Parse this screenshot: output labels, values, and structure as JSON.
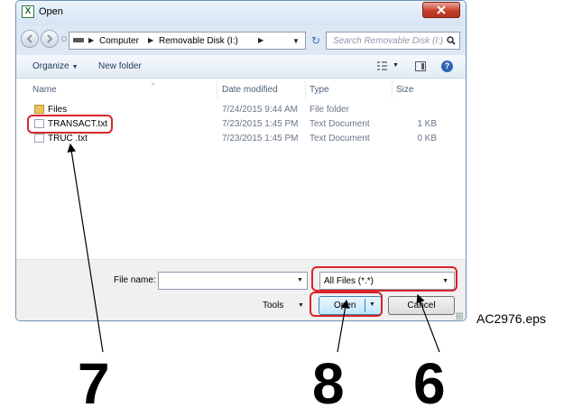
{
  "window": {
    "title": "Open",
    "app_icon": "X"
  },
  "address": {
    "crumbs": [
      "Computer",
      "Removable Disk (I:)"
    ],
    "search_placeholder": "Search Removable Disk (I:)"
  },
  "toolbar": {
    "organize": "Organize",
    "new_folder": "New folder"
  },
  "columns": {
    "name": "Name",
    "date": "Date modified",
    "type": "Type",
    "size": "Size"
  },
  "files": [
    {
      "name": "Files",
      "date": "7/24/2015 9:44 AM",
      "type": "File folder",
      "size": "",
      "icon": "folder-icon"
    },
    {
      "name": "TRANSACT.txt",
      "date": "7/23/2015 1:45 PM",
      "type": "Text Document",
      "size": "1 KB",
      "icon": "text-file-icon"
    },
    {
      "name": "TRUC .txt",
      "date": "7/23/2015 1:45 PM",
      "type": "Text Document",
      "size": "0 KB",
      "icon": "text-file-icon"
    }
  ],
  "bottom": {
    "file_name_label": "File name:",
    "file_name_value": "",
    "filter_value": "All Files (*.*)",
    "tools_label": "Tools",
    "open_label": "Open",
    "cancel_label": "Cancel"
  },
  "annotations": {
    "file_callout": "7",
    "open_callout": "8",
    "filter_callout": "6",
    "figure_id": "AC2976.eps",
    "callout_color": "#d9242a"
  }
}
